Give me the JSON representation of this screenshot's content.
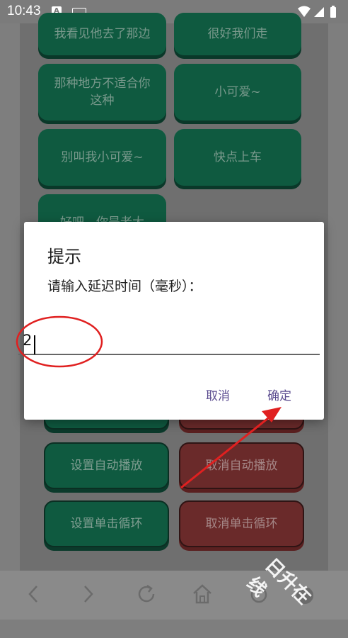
{
  "status_bar": {
    "time": "10:43",
    "notif_icon_letter": "A"
  },
  "background_grid": [
    {
      "label": "我看见他去了那边"
    },
    {
      "label": "很好我们走"
    },
    {
      "label": "那种地方不适合你这种"
    },
    {
      "label": "小可爱~"
    },
    {
      "label": "别叫我小可爱~"
    },
    {
      "label": "快点上车"
    },
    {
      "label": "好吧，你是老大"
    }
  ],
  "controls": {
    "set_autoplay": "设置自动播放",
    "cancel_autoplay": "取消自动播放",
    "set_single_loop": "设置单击循环",
    "cancel_single_loop": "取消单击循环"
  },
  "dialog": {
    "title": "提示",
    "message": "请输入延迟时间（毫秒）：",
    "input_value": "2",
    "cancel": "取消",
    "confirm": "确定"
  },
  "watermark": "日升在线",
  "colors": {
    "accent_green": "#0f5a40",
    "accent_red": "#6a2a2a",
    "dialog_button": "#5a4b8f",
    "annotation_red": "#e02020"
  }
}
